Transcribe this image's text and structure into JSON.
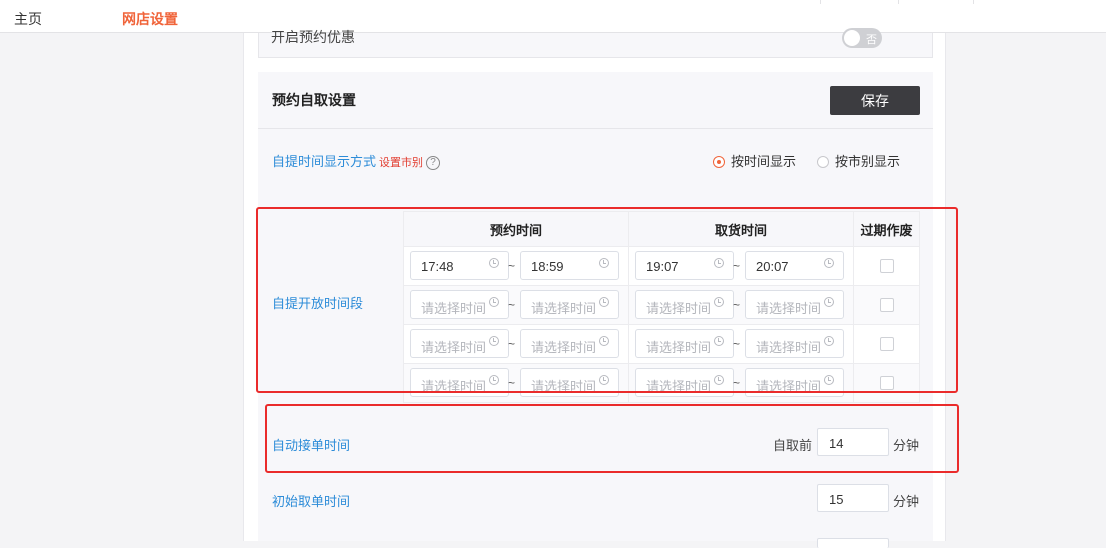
{
  "nav": {
    "home": "主页",
    "shop_settings": "网店设置"
  },
  "prev_section": {
    "label": "开启预约优惠",
    "toggle_text": "否"
  },
  "section": {
    "title": "预约自取设置",
    "save_label": "保存",
    "display_mode": {
      "label": "自提时间显示方式",
      "sub_link": "设置市别",
      "help_symbol": "?",
      "options": [
        "按时间显示",
        "按市别显示"
      ],
      "selected": "按时间显示"
    },
    "open_periods": {
      "label": "自提开放时间段",
      "headers": [
        "预约时间",
        "取货时间",
        "过期作废"
      ],
      "separator": "~",
      "placeholder": "请选择时间",
      "rows": [
        {
          "reserve_start": "17:48",
          "reserve_end": "18:59",
          "pickup_start": "19:07",
          "pickup_end": "20:07",
          "expire": false
        },
        {
          "reserve_start": "",
          "reserve_end": "",
          "pickup_start": "",
          "pickup_end": "",
          "expire": false
        },
        {
          "reserve_start": "",
          "reserve_end": "",
          "pickup_start": "",
          "pickup_end": "",
          "expire": false
        },
        {
          "reserve_start": "",
          "reserve_end": "",
          "pickup_start": "",
          "pickup_end": "",
          "expire": false
        }
      ]
    },
    "auto_accept": {
      "label": "自动接单时间",
      "prefix": "自取前",
      "value": "14",
      "unit": "分钟"
    },
    "initial_pickup": {
      "label": "初始取单时间",
      "value": "15",
      "unit": "分钟"
    }
  },
  "colors": {
    "accent": "#f0643a",
    "link": "#2d8cd8",
    "highlight": "#ea2b2b",
    "button": "#3c3c40"
  }
}
